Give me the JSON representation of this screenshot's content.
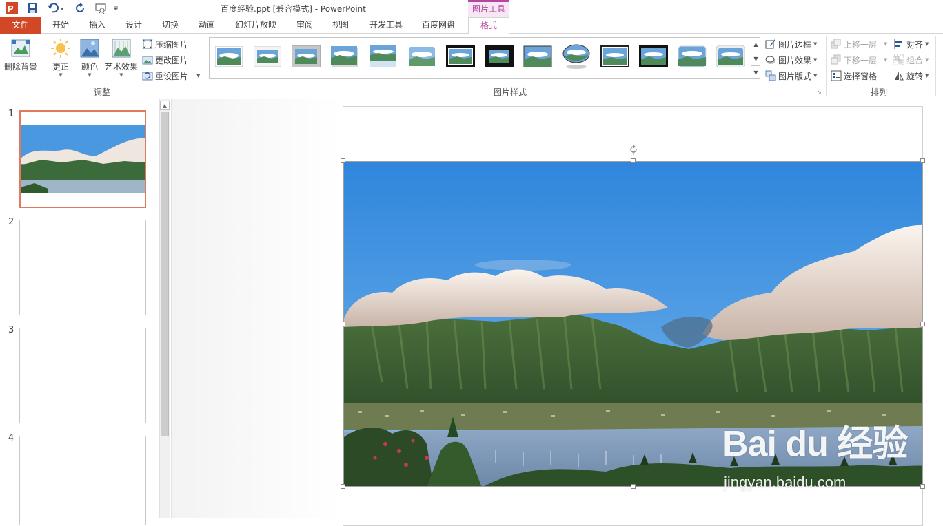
{
  "window": {
    "title": "百度经验.ppt [兼容模式] - PowerPoint",
    "context_tab_label": "图片工具"
  },
  "tabs": [
    "文件",
    "开始",
    "插入",
    "设计",
    "切换",
    "动画",
    "幻灯片放映",
    "审阅",
    "视图",
    "开发工具",
    "百度网盘",
    "格式"
  ],
  "active_tab": "格式",
  "ribbon": {
    "adjust": {
      "remove_bg": "删除背景",
      "corrections": "更正",
      "color": "颜色",
      "artistic": "艺术效果",
      "compress": "压缩图片",
      "change": "更改图片",
      "reset": "重设图片",
      "label": "调整"
    },
    "styles": {
      "label": "图片样式",
      "border": "图片边框",
      "effects": "图片效果",
      "layout": "图片版式"
    },
    "arrange": {
      "label": "排列",
      "bring_forward": "上移一层",
      "send_backward": "下移一层",
      "selection_pane": "选择窗格",
      "align": "对齐",
      "group": "组合",
      "rotate": "旋转"
    }
  },
  "slides": [
    {
      "number": "1",
      "selected": true
    },
    {
      "number": "2",
      "selected": false
    },
    {
      "number": "3",
      "selected": false
    },
    {
      "number": "4",
      "selected": false
    }
  ],
  "watermark": {
    "brand": "Bai du 经验",
    "url": "jingyan.baidu.com"
  },
  "colors": {
    "file_tab": "#d24726",
    "picture_tools_accent": "#b4479f",
    "selected_slide_border": "#e07a5f"
  }
}
